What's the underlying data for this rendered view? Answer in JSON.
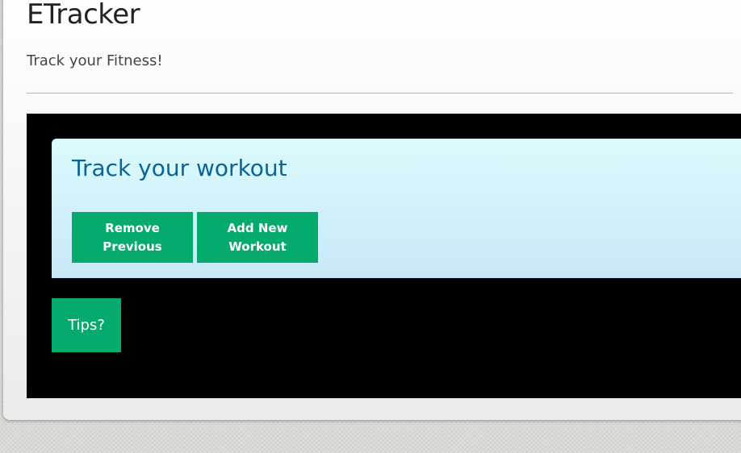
{
  "app": {
    "title": "ETracker",
    "tagline": "Track your Fitness!"
  },
  "workout": {
    "title": "Track your workout",
    "remove_button_lines": [
      "Remove",
      "Previous"
    ],
    "add_button_lines": [
      "Add New",
      "Workout"
    ]
  },
  "tips": {
    "button_label": "Tips?"
  },
  "colors": {
    "button_green": "#05aa6d",
    "heading_blue": "#0a6496",
    "panel_black": "#000000",
    "card_light_blue": "#c7e8f8"
  }
}
